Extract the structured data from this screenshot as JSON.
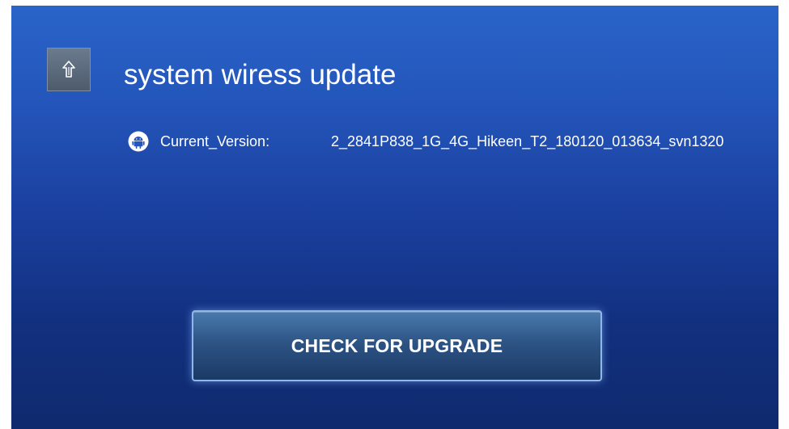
{
  "header": {
    "title": "system wiress update",
    "icon": "upload-arrow-icon"
  },
  "version": {
    "icon": "android-icon",
    "label": "Current_Version:",
    "value": "2_2841P838_1G_4G_Hikeen_T2_180120_013634_svn1320"
  },
  "actions": {
    "check_upgrade_label": "CHECK FOR UPGRADE"
  },
  "colors": {
    "background_top": "#2a64c9",
    "background_bottom": "#0f2a6d",
    "button_border": "#8fb8e8",
    "text": "#ffffff"
  }
}
